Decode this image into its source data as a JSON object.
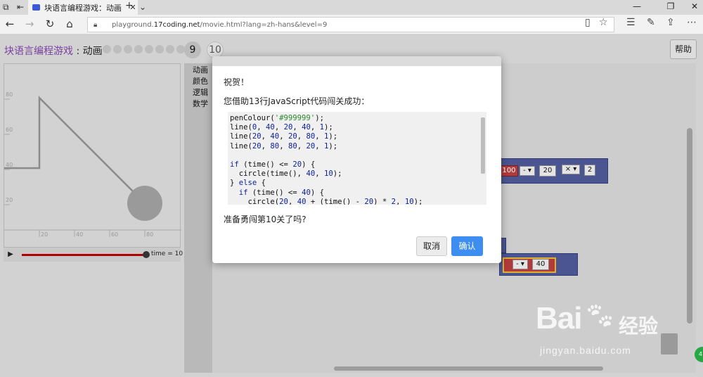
{
  "browser": {
    "tab_title": "块语言编程游戏：动画",
    "tab_close": "✕",
    "new_tab": "+",
    "tab_menu": "⌄",
    "url_prefix": "playground.",
    "url_domain": "17coding.net",
    "url_path": "/movie.html?lang=zh-hans&level=9",
    "win_min": "—",
    "win_max": "❐",
    "win_close": "✕"
  },
  "page": {
    "game_name": "块语言编程游戏",
    "separator": " : ",
    "game_mode": "动画",
    "current_level": "9",
    "next_level": "10",
    "help_label": "帮助"
  },
  "viz": {
    "y_ticks": [
      "80",
      "60",
      "40",
      "20"
    ],
    "x_ticks": [
      "20",
      "40",
      "60",
      "80"
    ],
    "time_label": "time = 10",
    "play_icon": "▶"
  },
  "toolbox": {
    "categories": [
      "动画",
      "颜色",
      "逻辑",
      "数学"
    ]
  },
  "blocks": {
    "a": "100",
    "op1": "- ▾",
    "v1": "20",
    "op2": "× ▾",
    "v2": "2",
    "op3": "- ▾",
    "v3": "40"
  },
  "dialog": {
    "greeting": "祝贺！",
    "message": "您借助13行JavaScript代码闯关成功：",
    "code_lines": [
      "penColour('#999999');",
      "line(0, 40, 20, 40, 1);",
      "line(20, 40, 20, 80, 1);",
      "line(20, 80, 80, 20, 1);",
      "",
      "if (time() <= 20) {",
      "  circle(time(), 40, 10);",
      "} else {",
      "  if (time() <= 40) {",
      "    circle(20, 40 + (time() - 20) * 2, 10);"
    ],
    "question": "准备勇闯第10关了吗?",
    "cancel_label": "取消",
    "ok_label": "确认"
  },
  "watermark": {
    "brand": "Bai",
    "brand_paw": "du",
    "brand_cn": "经验",
    "sub": "jingyan.baidu.com"
  },
  "colors": {
    "accent": "#3d8ef0",
    "game_name": "#7b3fa0",
    "block": "#4a5591",
    "time_bar": "#b00000"
  }
}
